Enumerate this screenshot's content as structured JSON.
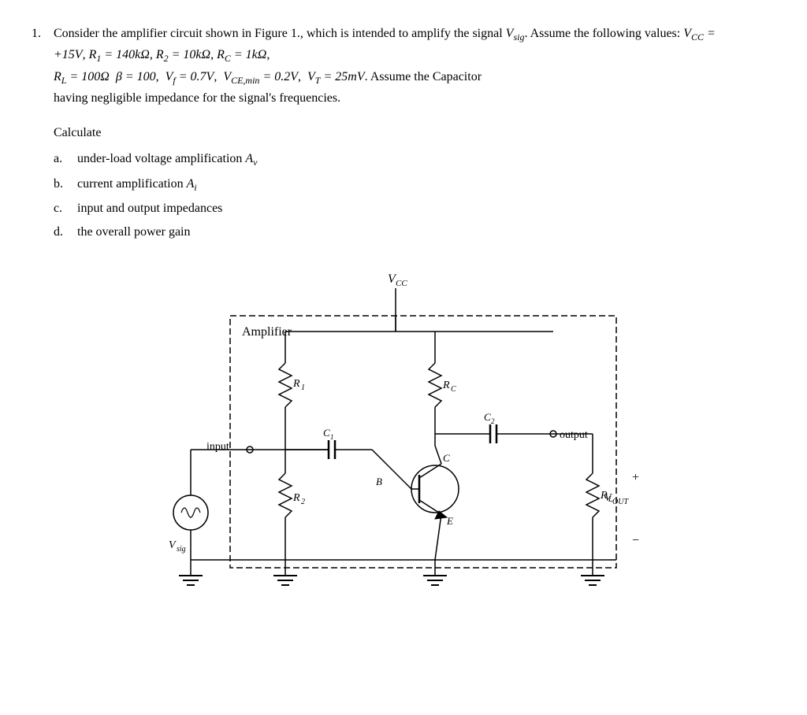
{
  "problem": {
    "number": "1.",
    "intro": "Consider the amplifier circuit shown in Figure 1., which is intended to amplify the signal V",
    "intro_sub": "sig",
    "intro_cont": ". Assume the following values: V",
    "vcc_sub": "CC",
    "vcc_val": " = +15V, R",
    "r1_sub": "1",
    "r1_val": " = 140kΩ, R",
    "r2_sub": "2",
    "r2_val": " = 10kΩ, R",
    "rc_sub": "C",
    "rc_val": " = 1kΩ,",
    "line2": "R",
    "rl_sub": "L",
    "rl_val": " = 100Ω  β = 100,  V",
    "vf_sub": "f",
    "vf_val": " = 0.7V, V",
    "vce_sub": "CE,min",
    "vce_val": " = 0.2V, V",
    "vt_sub": "T",
    "vt_val": " = 25mV.  Assume the Capacitor",
    "line3": "having negligible impedance for the signal's frequencies.",
    "calculate_label": "Calculate",
    "items": [
      {
        "label": "a.",
        "text": "under-load voltage amplification A",
        "sub": "v"
      },
      {
        "label": "b.",
        "text": "current amplification A",
        "sub": "i"
      },
      {
        "label": "c.",
        "text": "input and output impedances",
        "sub": ""
      },
      {
        "label": "d.",
        "text": "the overall power gain",
        "sub": ""
      }
    ]
  },
  "circuit": {
    "vcc_label": "V",
    "vcc_sub": "CC",
    "amplifier_label": "Amplifier",
    "input_label": "input",
    "output_label": "output",
    "r1_label": "R",
    "r1_sub": "1",
    "r2_label": "R",
    "r2_sub": "2",
    "rc_label": "R",
    "rc_sub": "C",
    "rl_label": "R",
    "rl_sub": "L",
    "c1_label": "C",
    "c1_sub": "1",
    "c2_label": "C",
    "c2_sub": "2",
    "vsig_label": "V",
    "vsig_sub": "sig",
    "vout_label": "V",
    "vout_sub": "OUT",
    "b_label": "B",
    "c_label": "C",
    "e_label": "E",
    "plus_label": "+",
    "minus_label": "−"
  }
}
